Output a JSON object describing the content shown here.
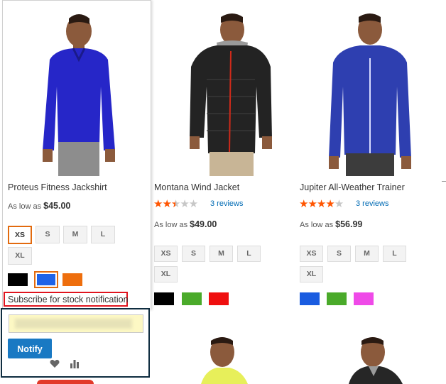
{
  "products": [
    {
      "name": "Proteus Fitness Jackshirt",
      "price_prefix": "As low as",
      "price": "$45.00",
      "sizes": [
        "XS",
        "S",
        "M",
        "L",
        "XL"
      ],
      "selected_size": "XS",
      "colors": [
        "#000000",
        "#1e63e8",
        "#ee6e0d"
      ],
      "selected_color": "#1e63e8"
    },
    {
      "name": "Montana Wind Jacket",
      "rating": 2.5,
      "reviews": "3 reviews",
      "price_prefix": "As low as",
      "price": "$49.00",
      "sizes": [
        "XS",
        "S",
        "M",
        "L",
        "XL"
      ],
      "colors": [
        "#000000",
        "#4aaa2a",
        "#ef0f0f"
      ]
    },
    {
      "name": "Jupiter All-Weather Trainer",
      "rating": 4,
      "reviews": "3 reviews",
      "price_prefix": "As low as",
      "price": "$56.99",
      "sizes": [
        "XS",
        "S",
        "M",
        "L",
        "XL"
      ],
      "colors": [
        "#1a5ce0",
        "#4aaa2a",
        "#ef4ae8"
      ]
    }
  ],
  "stock_alert": {
    "subscribe_label": "Subscribe for stock notification",
    "email_placeholder": "",
    "notify_label": "Notify",
    "wishlist_icon": "heart-icon",
    "compare_icon": "bar-chart-icon"
  }
}
